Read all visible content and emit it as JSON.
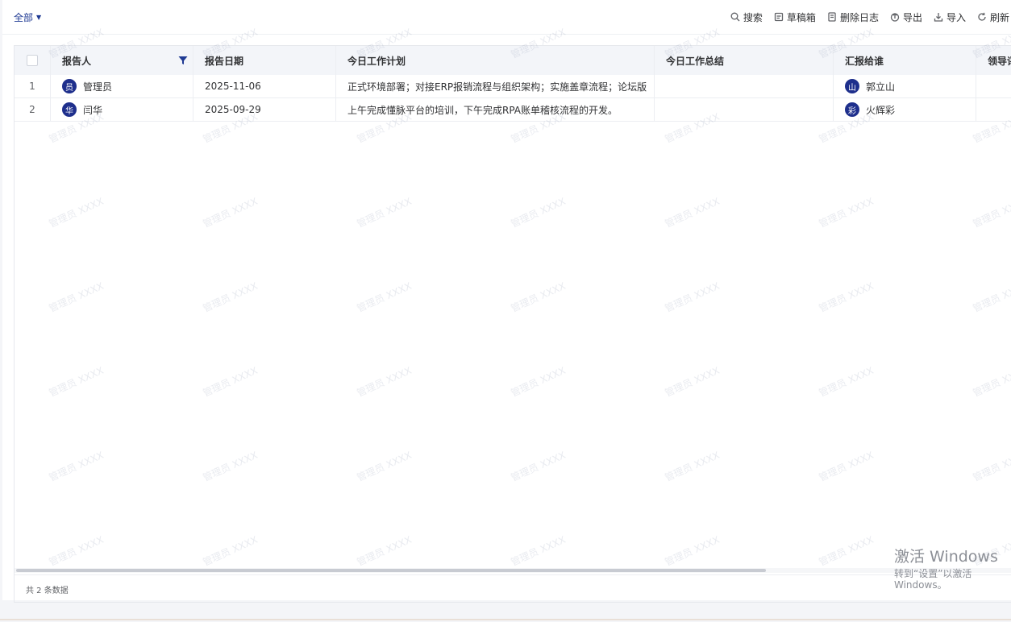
{
  "filter": {
    "label": "全部"
  },
  "toolbar": {
    "search": "搜索",
    "drafts": "草稿箱",
    "delete_log": "删除日志",
    "export": "导出",
    "import": "导入",
    "refresh": "刷新"
  },
  "table": {
    "headers": [
      "报告人",
      "报告日期",
      "今日工作计划",
      "今日工作总结",
      "汇报给谁",
      "领导评"
    ],
    "rows": [
      {
        "index": "1",
        "reporter_avatar": "员",
        "reporter": "管理员",
        "date": "2025-11-06",
        "plan": "正式环境部署；对接ERP报销流程与组织架构；实施盖章流程；论坛版",
        "summary": "",
        "report_to_avatar": "山",
        "report_to": "郭立山",
        "leader_comment": ""
      },
      {
        "index": "2",
        "reporter_avatar": "华",
        "reporter": "闫华",
        "date": "2025-09-29",
        "plan": "上午完成懂脉平台的培训，下午完成RPA账单稽核流程的开发。",
        "summary": "",
        "report_to_avatar": "彩",
        "report_to": "火辉彩",
        "leader_comment": ""
      }
    ],
    "total_text": "共 2 条数据"
  },
  "watermark_text": "管理员 XXXX",
  "os_notice": {
    "title": "激活 Windows",
    "subtitle": "转到“设置”以激活 Windows。"
  },
  "colors": {
    "accent": "#1f3a93",
    "avatar_bg": "#1e2f8c"
  }
}
